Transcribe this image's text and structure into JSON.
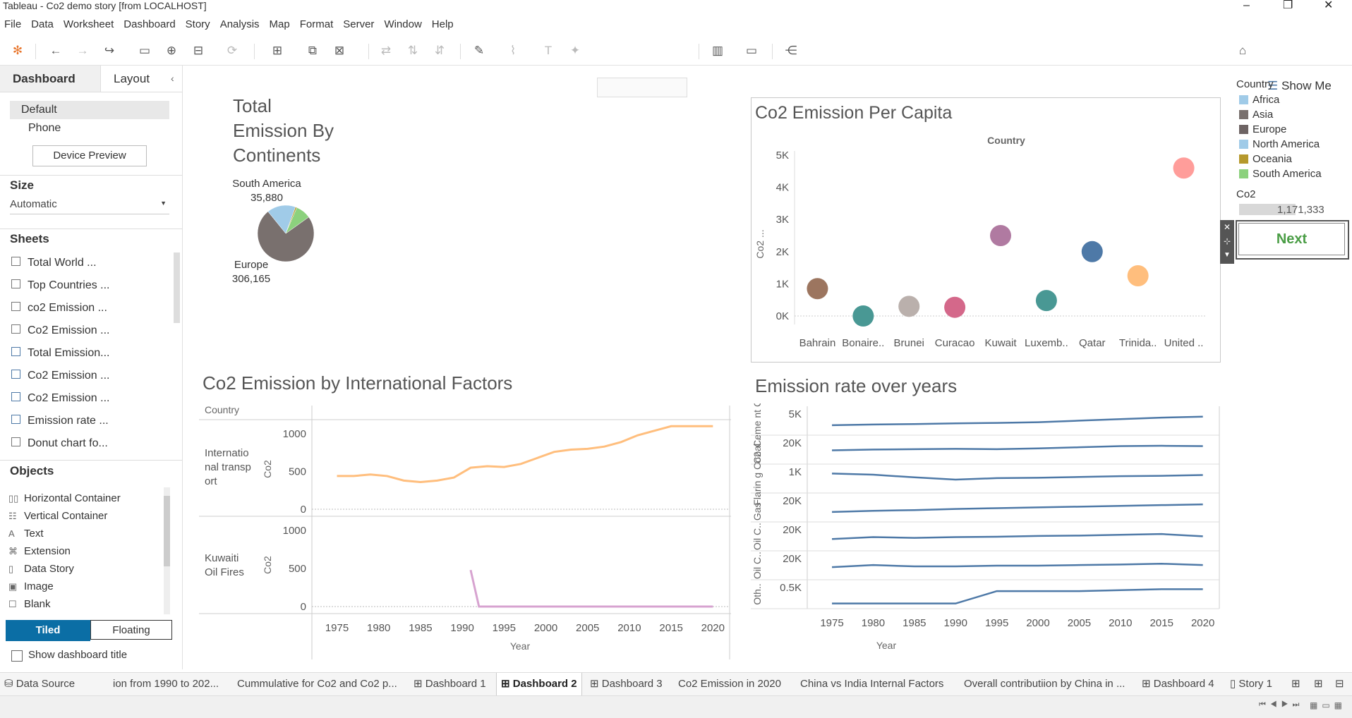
{
  "window": {
    "title": "Tableau - Co2 demo story [from LOCALHOST]"
  },
  "menu": [
    "File",
    "Data",
    "Worksheet",
    "Dashboard",
    "Story",
    "Analysis",
    "Map",
    "Format",
    "Server",
    "Window",
    "Help"
  ],
  "toolbar": {
    "show_me": "Show Me"
  },
  "left_panel": {
    "tabs": {
      "dashboard": "Dashboard",
      "layout": "Layout"
    },
    "devices": {
      "default": "Default",
      "phone": "Phone",
      "preview_button": "Device Preview"
    },
    "size": {
      "heading": "Size",
      "value": "Automatic"
    },
    "sheets": {
      "heading": "Sheets",
      "items": [
        "Total World ...",
        "Top Countries ...",
        "co2 Emission ...",
        "Co2 Emission ...",
        "Total Emission...",
        "Co2 Emission ...",
        "Co2 Emission ...",
        "Emission rate ...",
        "Donut chart fo..."
      ]
    },
    "objects": {
      "heading": "Objects",
      "items": [
        {
          "label": "Horizontal Container",
          "icon": "horizontal-container-icon"
        },
        {
          "label": "Vertical Container",
          "icon": "vertical-container-icon"
        },
        {
          "label": "Text",
          "icon": "text-icon"
        },
        {
          "label": "Extension",
          "icon": "extension-icon"
        },
        {
          "label": "Data Story",
          "icon": "data-story-icon"
        },
        {
          "label": "Image",
          "icon": "image-icon"
        },
        {
          "label": "Blank",
          "icon": "blank-icon"
        }
      ]
    },
    "mode": {
      "tiled": "Tiled",
      "floating": "Floating"
    },
    "show_title": "Show dashboard title"
  },
  "legend": {
    "heading": "Country",
    "items": [
      {
        "label": "Africa",
        "color": "#a0cbe8"
      },
      {
        "label": "Asia",
        "color": "#79706e"
      },
      {
        "label": "Europe",
        "color": "#6e6464"
      },
      {
        "label": "North America",
        "color": "#a0cbe8"
      },
      {
        "label": "Oceania",
        "color": "#b6992d"
      },
      {
        "label": "South America",
        "color": "#8cd17d"
      }
    ],
    "co2_heading": "Co2",
    "co2_value": "1,171,333"
  },
  "next_button": "Next",
  "charts": {
    "pie": {
      "title_lines": [
        "Total",
        "Emission By",
        "Continents"
      ]
    },
    "scatter": {
      "title": "Co2 Emission Per Capita",
      "header": "Country",
      "ylabel": "Co2 ...",
      "y_ticks": [
        "0K",
        "1K",
        "2K",
        "3K",
        "4K",
        "5K"
      ]
    },
    "intl": {
      "title": "Co2 Emission by International Factors",
      "header": "Country",
      "row_labels": [
        "Internatio nal transp ort",
        "Kuwaiti Oil Fires"
      ],
      "ylabel": "Co2",
      "y_ticks": [
        "0",
        "500",
        "1000"
      ],
      "xlabel": "Year",
      "x_ticks": [
        "1975",
        "1980",
        "1985",
        "1990",
        "1995",
        "2000",
        "2005",
        "2010",
        "2015",
        "2020"
      ]
    },
    "rate": {
      "title": "Emission rate over years",
      "ylabel_rows": [
        "Ceme nt C..",
        "Coal ..",
        "Flarin g Co2",
        "Gas ..",
        "Oil C..",
        "Oil C..",
        "Oth.."
      ],
      "row_ticks": [
        "5K",
        "20K",
        "1K",
        "20K",
        "20K",
        "20K",
        "0.5K"
      ],
      "xlabel": "Year",
      "x_ticks": [
        "1975",
        "1980",
        "1985",
        "1990",
        "1995",
        "2000",
        "2005",
        "2010",
        "2015",
        "2020"
      ]
    }
  },
  "chart_data": [
    {
      "type": "pie",
      "title": "Total Emission By Continents",
      "slices": [
        {
          "label": "Europe",
          "value": 306165,
          "color": "#79706e"
        },
        {
          "label": "North America",
          "value": 68000,
          "color": "#a0cbe8"
        },
        {
          "label": "Oceania",
          "value": 3500,
          "color": "#b6992d"
        },
        {
          "label": "South America",
          "value": 35880,
          "color": "#8cd17d"
        }
      ],
      "labels": [
        {
          "name": "South America",
          "value": "35,880"
        },
        {
          "name": "Europe",
          "value": "306,165"
        }
      ]
    },
    {
      "type": "scatter",
      "title": "Co2 Emission Per Capita",
      "categories": [
        "Bahrain",
        "Bonaire..",
        "Brunei",
        "Curacao",
        "Kuwait",
        "Luxemb..",
        "Qatar",
        "Trinida..",
        "United .."
      ],
      "values": [
        850,
        0,
        300,
        270,
        2500,
        480,
        2000,
        1250,
        4600
      ],
      "colors": [
        "#9c755f",
        "#499894",
        "#bab0ac",
        "#d4688a",
        "#b07aa1",
        "#499894",
        "#4e79a7",
        "#ffbe7d",
        "#ff9d9a"
      ],
      "ylim": [
        0,
        5000
      ]
    },
    {
      "type": "line",
      "title": "Co2 Emission by International Factors",
      "x": [
        1975,
        1977,
        1979,
        1981,
        1983,
        1985,
        1987,
        1989,
        1991,
        1993,
        1995,
        1997,
        1999,
        2001,
        2003,
        2005,
        2007,
        2009,
        2011,
        2013,
        2015,
        2017,
        2019,
        2020
      ],
      "series": [
        {
          "name": "Internatio nal transp ort",
          "color": "#ffbe7d",
          "values": [
            440,
            440,
            460,
            440,
            380,
            360,
            380,
            420,
            550,
            570,
            560,
            600,
            680,
            760,
            790,
            800,
            830,
            890,
            980,
            1040,
            1100,
            1150,
            1180,
            1260
          ]
        },
        {
          "name": "Kuwaiti Oil Fires",
          "color": "#d7a3d0",
          "x": [
            1991,
            1992,
            1995,
            2000,
            2005,
            2010,
            2015,
            2020
          ],
          "values": [
            480,
            0,
            0,
            0,
            0,
            0,
            0,
            0
          ]
        }
      ],
      "ylim": [
        0,
        1000
      ]
    },
    {
      "type": "line",
      "title": "Emission rate over years",
      "x": [
        1975,
        1980,
        1985,
        1990,
        1995,
        2000,
        2005,
        2010,
        2015,
        2020
      ],
      "series": [
        {
          "name": "Ceme nt C..",
          "values": [
            0.3,
            0.34,
            0.36,
            0.4,
            0.42,
            0.46,
            0.54,
            0.62,
            0.7,
            0.75
          ]
        },
        {
          "name": "Coal ..",
          "values": [
            0.5,
            0.54,
            0.56,
            0.58,
            0.56,
            0.6,
            0.66,
            0.72,
            0.74,
            0.72
          ]
        },
        {
          "name": "Flarin g Co2",
          "values": [
            0.8,
            0.74,
            0.6,
            0.48,
            0.56,
            0.58,
            0.62,
            0.66,
            0.68,
            0.72
          ]
        },
        {
          "name": "Gas ..",
          "values": [
            0.3,
            0.36,
            0.4,
            0.46,
            0.5,
            0.54,
            0.58,
            0.62,
            0.66,
            0.7
          ]
        },
        {
          "name": "Oil C..",
          "values": [
            0.4,
            0.5,
            0.46,
            0.5,
            0.52,
            0.56,
            0.58,
            0.62,
            0.66,
            0.54
          ]
        },
        {
          "name": "Oil C..",
          "values": [
            0.44,
            0.55,
            0.48,
            0.48,
            0.52,
            0.52,
            0.55,
            0.58,
            0.62,
            0.55
          ]
        },
        {
          "name": "Oth..",
          "values": [
            0.05,
            0.05,
            0.05,
            0.05,
            0.7,
            0.7,
            0.7,
            0.75,
            0.8,
            0.8
          ]
        }
      ]
    }
  ]
}
